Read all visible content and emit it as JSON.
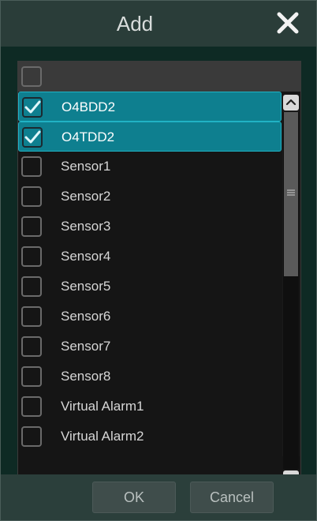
{
  "dialog": {
    "title": "Add"
  },
  "header": {
    "select_all_checked": false
  },
  "items": [
    {
      "label": "O4BDD2",
      "checked": true
    },
    {
      "label": "O4TDD2",
      "checked": true
    },
    {
      "label": "Sensor1",
      "checked": false
    },
    {
      "label": "Sensor2",
      "checked": false
    },
    {
      "label": "Sensor3",
      "checked": false
    },
    {
      "label": "Sensor4",
      "checked": false
    },
    {
      "label": "Sensor5",
      "checked": false
    },
    {
      "label": "Sensor6",
      "checked": false
    },
    {
      "label": "Sensor7",
      "checked": false
    },
    {
      "label": "Sensor8",
      "checked": false
    },
    {
      "label": "Virtual Alarm1",
      "checked": false
    },
    {
      "label": "Virtual Alarm2",
      "checked": false
    }
  ],
  "footer": {
    "ok_label": "OK",
    "cancel_label": "Cancel"
  },
  "colors": {
    "selected_row": "#0e7f8f",
    "dialog_bg": "#2b3f3b",
    "list_bg": "#151515"
  }
}
